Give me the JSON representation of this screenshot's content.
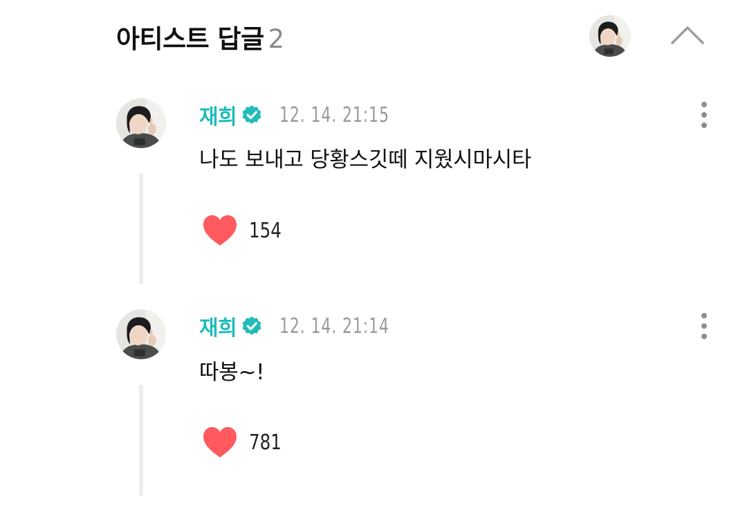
{
  "header": {
    "title": "아티스트 답글",
    "count": "2",
    "avatar_icon": "artist-avatar",
    "collapse_icon": "chevron-up-icon"
  },
  "colors": {
    "author": "#1fbcb9",
    "verified_badge": "#1fbcb9",
    "heart": "#ff5a5f",
    "timestamp": "#9a9a9a",
    "thread_line": "#ededed"
  },
  "comments": [
    {
      "author": "재희",
      "verified": true,
      "timestamp": "12. 14. 21:15",
      "text": "나도 보내고 당황스깃떼 지웠시마시타",
      "likes": "154"
    },
    {
      "author": "재희",
      "verified": true,
      "timestamp": "12. 14. 21:14",
      "text": "따봉~!",
      "likes": "781"
    }
  ]
}
